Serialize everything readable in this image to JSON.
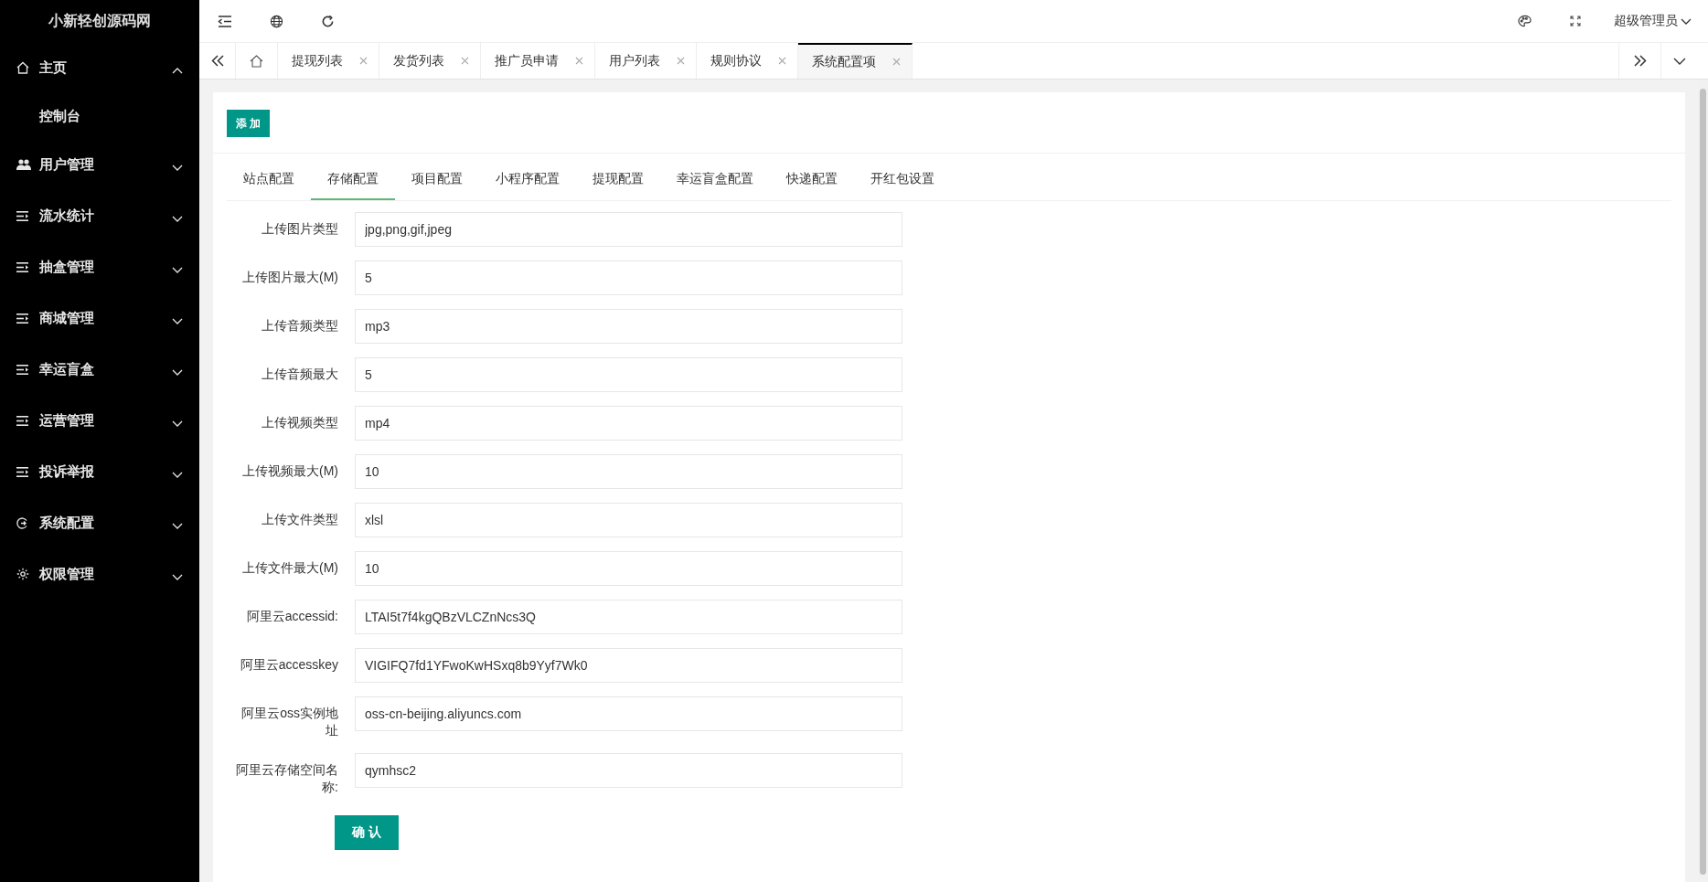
{
  "sidebar": {
    "logo": "小新轻创源码网",
    "items": [
      {
        "label": "主页",
        "kind": "home",
        "expanded": true,
        "children": [
          {
            "label": "控制台"
          }
        ]
      },
      {
        "label": "用户管理",
        "kind": "users",
        "expanded": false
      },
      {
        "label": "流水统计",
        "kind": "list",
        "expanded": false
      },
      {
        "label": "抽盒管理",
        "kind": "list",
        "expanded": false
      },
      {
        "label": "商城管理",
        "kind": "list",
        "expanded": false
      },
      {
        "label": "幸运盲盒",
        "kind": "list",
        "expanded": false
      },
      {
        "label": "运营管理",
        "kind": "list",
        "expanded": false
      },
      {
        "label": "投诉举报",
        "kind": "list",
        "expanded": false
      },
      {
        "label": "系统配置",
        "kind": "cycle",
        "expanded": false
      },
      {
        "label": "权限管理",
        "kind": "gear",
        "expanded": false
      }
    ]
  },
  "topbar": {
    "user": "超级管理员"
  },
  "page_tabs": [
    {
      "label": "提现列表",
      "selected": false
    },
    {
      "label": "发货列表",
      "selected": false
    },
    {
      "label": "推广员申请",
      "selected": false
    },
    {
      "label": "用户列表",
      "selected": false
    },
    {
      "label": "规则协议",
      "selected": false
    },
    {
      "label": "系统配置项",
      "selected": true
    }
  ],
  "add_button": "添 加",
  "config_tabs": [
    {
      "label": "站点配置",
      "selected": false
    },
    {
      "label": "存储配置",
      "selected": true
    },
    {
      "label": "项目配置",
      "selected": false
    },
    {
      "label": "小程序配置",
      "selected": false
    },
    {
      "label": "提现配置",
      "selected": false
    },
    {
      "label": "幸运盲盒配置",
      "selected": false
    },
    {
      "label": "快递配置",
      "selected": false
    },
    {
      "label": "开红包设置",
      "selected": false
    }
  ],
  "fields": [
    {
      "label": "上传图片类型",
      "value": "jpg,png,gif,jpeg"
    },
    {
      "label": "上传图片最大(M)",
      "value": "5"
    },
    {
      "label": "上传音频类型",
      "value": "mp3"
    },
    {
      "label": "上传音频最大",
      "value": "5"
    },
    {
      "label": "上传视频类型",
      "value": "mp4"
    },
    {
      "label": "上传视频最大(M)",
      "value": "10"
    },
    {
      "label": "上传文件类型",
      "value": "xlsl"
    },
    {
      "label": "上传文件最大(M)",
      "value": "10"
    },
    {
      "label": "阿里云accessid:",
      "value": "LTAI5t7f4kgQBzVLCZnNcs3Q"
    },
    {
      "label": "阿里云accesskey",
      "value": "VIGIFQ7fd1YFwoKwHSxq8b9Yyf7Wk0"
    },
    {
      "label": "阿里云oss实例地址",
      "value": "oss-cn-beijing.aliyuncs.com"
    },
    {
      "label": "阿里云存储空间名称:",
      "value": "qymhsc2"
    }
  ],
  "submit_button": "确 认"
}
